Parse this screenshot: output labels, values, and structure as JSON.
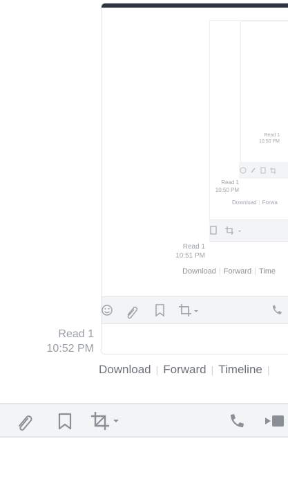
{
  "message": {
    "read_label": "Read 1",
    "time": "10:52 PM",
    "actions": [
      "Download",
      "Forward",
      "Timeline"
    ]
  },
  "nested_1": {
    "read_label": "Read 1",
    "time": "10:51 PM",
    "actions": [
      "Download",
      "Forward",
      "Time"
    ]
  },
  "nested_2": {
    "read_label": "Read 1",
    "time": "10:50 PM",
    "actions": [
      "Download",
      "Forwa"
    ]
  },
  "toolbar": {
    "icons": [
      "attach-icon",
      "bookmark-icon",
      "crop-icon",
      "dropdown-caret-icon",
      "phone-icon",
      "video-icon"
    ]
  },
  "colors": {
    "toolbar_bg": "#f3f4f6",
    "icon": "#8a8e95",
    "text": "#6d7178"
  }
}
